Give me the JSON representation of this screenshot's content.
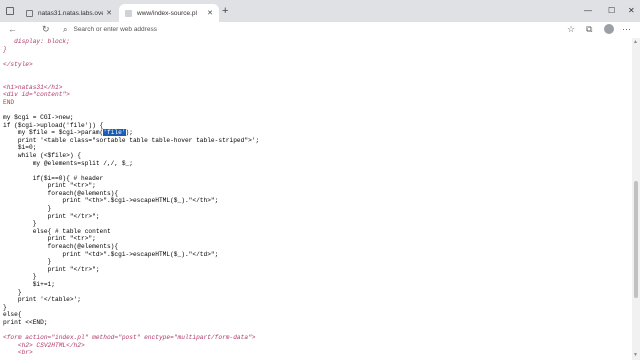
{
  "browser": {
    "tabs": [
      {
        "title": "natas31.natas.labs.overthewire.o",
        "active": false
      },
      {
        "title": "www/index-source.pl",
        "active": true
      }
    ],
    "new_tab": "+",
    "window_controls": {
      "minimize": "—",
      "maximize": "☐",
      "close": "✕"
    },
    "toolbar": {
      "back": "←",
      "refresh": "↻",
      "search_icon": "⌕",
      "address_placeholder": "Search or enter web address",
      "favorites": "☆",
      "collections": "⧉",
      "more": "⋯"
    }
  },
  "source_lines": [
    {
      "segments": [
        {
          "text": "   display: block;",
          "style": "it"
        }
      ]
    },
    {
      "segments": [
        {
          "text": "}",
          "style": "it"
        }
      ]
    },
    {
      "segments": [
        {
          "text": "",
          "style": ""
        }
      ]
    },
    {
      "segments": [
        {
          "text": "</style>",
          "style": "it"
        }
      ]
    },
    {
      "segments": [
        {
          "text": "",
          "style": ""
        }
      ]
    },
    {
      "segments": [
        {
          "text": "",
          "style": ""
        }
      ]
    },
    {
      "segments": [
        {
          "text": "<h1>natas31</h1>",
          "style": "it"
        }
      ]
    },
    {
      "segments": [
        {
          "text": "<div id=\"content\">",
          "style": "it"
        }
      ]
    },
    {
      "segments": [
        {
          "text": "END",
          "style": "red"
        }
      ]
    },
    {
      "segments": [
        {
          "text": "",
          "style": ""
        }
      ]
    },
    {
      "segments": [
        {
          "text": "my $cgi = CGI->new;",
          "style": ""
        }
      ]
    },
    {
      "segments": [
        {
          "text": "if ($cgi->upload('file')) {",
          "style": ""
        }
      ]
    },
    {
      "segments": [
        {
          "text": "    my $file = $cgi->param(",
          "style": ""
        },
        {
          "text": "'file'",
          "style": "sel"
        },
        {
          "text": ");",
          "style": ""
        }
      ]
    },
    {
      "segments": [
        {
          "text": "    print '<table class=\"sortable table table-hover table-striped\">';",
          "style": ""
        }
      ]
    },
    {
      "segments": [
        {
          "text": "    $i=0;",
          "style": ""
        }
      ]
    },
    {
      "segments": [
        {
          "text": "    while (<$file>) {",
          "style": ""
        }
      ]
    },
    {
      "segments": [
        {
          "text": "        my @elements=split /,/, $_;",
          "style": ""
        }
      ]
    },
    {
      "segments": [
        {
          "text": "",
          "style": ""
        }
      ]
    },
    {
      "segments": [
        {
          "text": "        if($i==0){ # header",
          "style": ""
        }
      ]
    },
    {
      "segments": [
        {
          "text": "            print \"<tr>\";",
          "style": ""
        }
      ]
    },
    {
      "segments": [
        {
          "text": "            foreach(@elements){",
          "style": ""
        }
      ]
    },
    {
      "segments": [
        {
          "text": "                print \"<th>\".$cgi->escapeHTML($_).\"</th>\";",
          "style": ""
        }
      ]
    },
    {
      "segments": [
        {
          "text": "            }",
          "style": ""
        }
      ]
    },
    {
      "segments": [
        {
          "text": "            print \"</tr>\";",
          "style": ""
        }
      ]
    },
    {
      "segments": [
        {
          "text": "        }",
          "style": ""
        }
      ]
    },
    {
      "segments": [
        {
          "text": "        else{ # table content",
          "style": ""
        }
      ]
    },
    {
      "segments": [
        {
          "text": "            print \"<tr>\";",
          "style": ""
        }
      ]
    },
    {
      "segments": [
        {
          "text": "            foreach(@elements){",
          "style": ""
        }
      ]
    },
    {
      "segments": [
        {
          "text": "                print \"<td>\".$cgi->escapeHTML($_).\"</td>\";",
          "style": ""
        }
      ]
    },
    {
      "segments": [
        {
          "text": "            }",
          "style": ""
        }
      ]
    },
    {
      "segments": [
        {
          "text": "            print \"</tr>\";",
          "style": ""
        }
      ]
    },
    {
      "segments": [
        {
          "text": "        }",
          "style": ""
        }
      ]
    },
    {
      "segments": [
        {
          "text": "        $i+=1;",
          "style": ""
        }
      ]
    },
    {
      "segments": [
        {
          "text": "    }",
          "style": ""
        }
      ]
    },
    {
      "segments": [
        {
          "text": "    print '</table>';",
          "style": ""
        }
      ]
    },
    {
      "segments": [
        {
          "text": "}",
          "style": ""
        }
      ]
    },
    {
      "segments": [
        {
          "text": "else{",
          "style": ""
        }
      ]
    },
    {
      "segments": [
        {
          "text": "print <<END;",
          "style": ""
        }
      ]
    },
    {
      "segments": [
        {
          "text": "",
          "style": ""
        }
      ]
    },
    {
      "segments": [
        {
          "text": "<form action=\"index.pl\" method=\"post\" enctype=\"multipart/form-data\">",
          "style": "it"
        }
      ]
    },
    {
      "segments": [
        {
          "text": "    <h2> CSV2HTML</h2>",
          "style": "it"
        }
      ]
    },
    {
      "segments": [
        {
          "text": "    <br>",
          "style": "it"
        }
      ]
    }
  ]
}
